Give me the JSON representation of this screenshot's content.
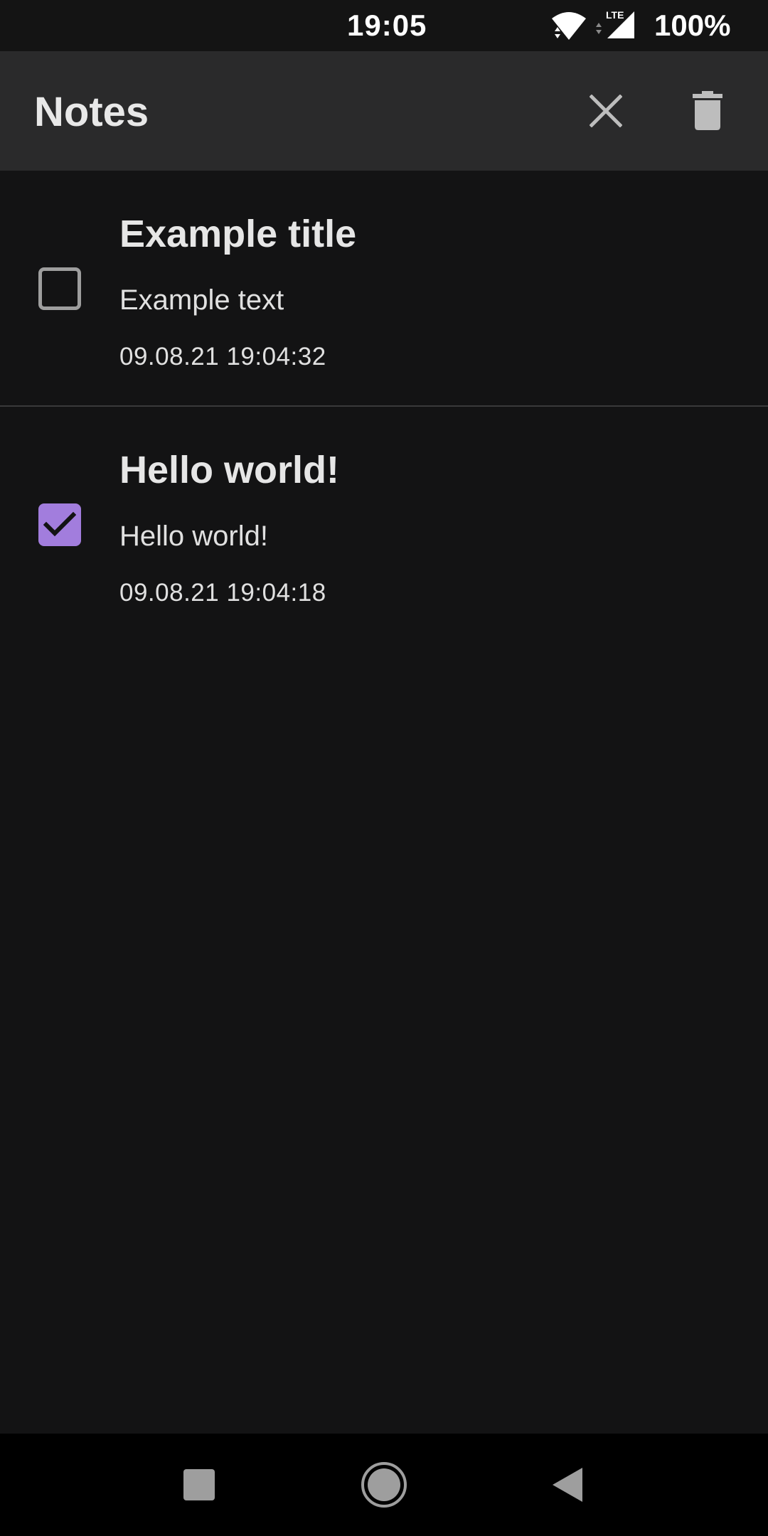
{
  "status_bar": {
    "time": "19:05",
    "wifi_icon": "wifi-icon",
    "network_label": "LTE",
    "battery": "100%"
  },
  "app_bar": {
    "title": "Notes",
    "close_icon": "close-icon",
    "delete_icon": "trash-icon"
  },
  "notes": [
    {
      "title": "Example title",
      "text": "Example text",
      "date": "09.08.21 19:04:32",
      "checked": false
    },
    {
      "title": "Hello world!",
      "text": "Hello world!",
      "date": "09.08.21 19:04:18",
      "checked": true
    }
  ],
  "nav_bar": {
    "recents_icon": "square-icon",
    "home_icon": "circle-icon",
    "back_icon": "triangle-back-icon"
  },
  "colors": {
    "background": "#131314",
    "app_bar": "#2a2a2b",
    "accent": "#a27ddd",
    "text": "#e6e6e6",
    "divider": "#3a3a3b"
  }
}
